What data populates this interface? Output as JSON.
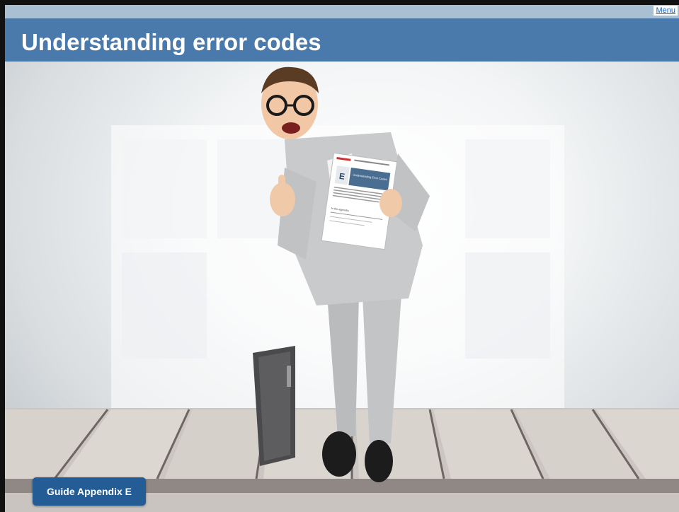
{
  "header": {
    "menu_label": "Menu",
    "title": "Understanding error codes"
  },
  "illustration": {
    "document_letter": "E",
    "document_heading": "Understanding Error Codes",
    "document_section": "In this appendix"
  },
  "footer": {
    "guide_button_label": "Guide Appendix E"
  },
  "colors": {
    "title_bar": "#4a79ac",
    "top_strip": "#a9c0d3",
    "button": "#245c96",
    "link": "#1a5fb4"
  }
}
